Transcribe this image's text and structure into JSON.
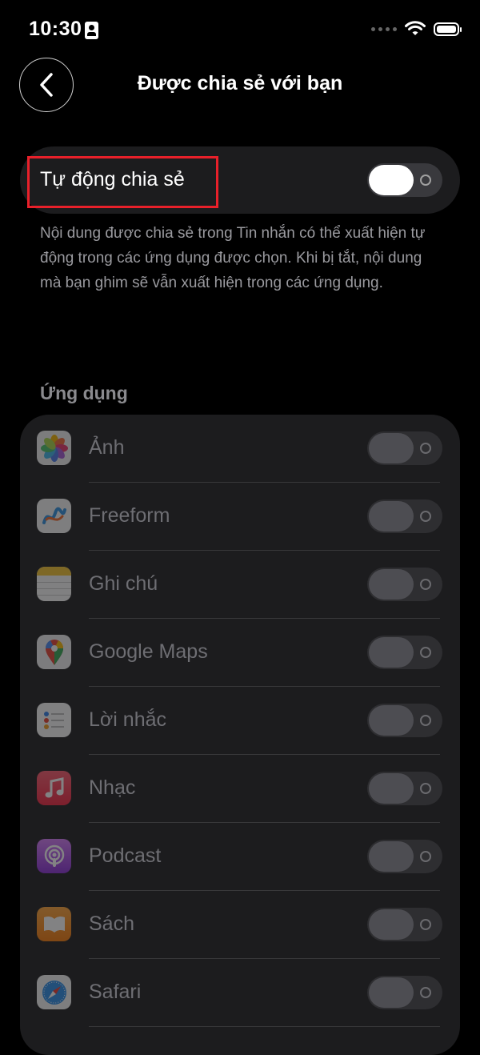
{
  "status_bar": {
    "time": "10:30"
  },
  "header": {
    "title": "Được chia sẻ với bạn"
  },
  "auto_share": {
    "label": "Tự động chia sẻ",
    "enabled": true,
    "description": "Nội dung được chia sẻ trong Tin nhắn có thể xuất hiện tự động trong các ứng dụng được chọn. Khi bị tắt, nội dung mà bạn ghim sẽ vẫn xuất hiện trong các ứng dụng."
  },
  "apps_section": {
    "header": "Ứng dụng",
    "items": [
      {
        "name": "Ảnh",
        "icon": "photos-icon",
        "enabled": false
      },
      {
        "name": "Freeform",
        "icon": "freeform-icon",
        "enabled": false
      },
      {
        "name": "Ghi chú",
        "icon": "notes-icon",
        "enabled": false
      },
      {
        "name": "Google Maps",
        "icon": "google-maps-icon",
        "enabled": false
      },
      {
        "name": "Lời nhắc",
        "icon": "reminders-icon",
        "enabled": false
      },
      {
        "name": "Nhạc",
        "icon": "music-icon",
        "enabled": false
      },
      {
        "name": "Podcast",
        "icon": "podcast-icon",
        "enabled": false
      },
      {
        "name": "Sách",
        "icon": "books-icon",
        "enabled": false
      },
      {
        "name": "Safari",
        "icon": "safari-icon",
        "enabled": false
      }
    ]
  },
  "colors": {
    "highlight": "#e8202a",
    "background": "#000000",
    "card": "#1c1c1e"
  }
}
